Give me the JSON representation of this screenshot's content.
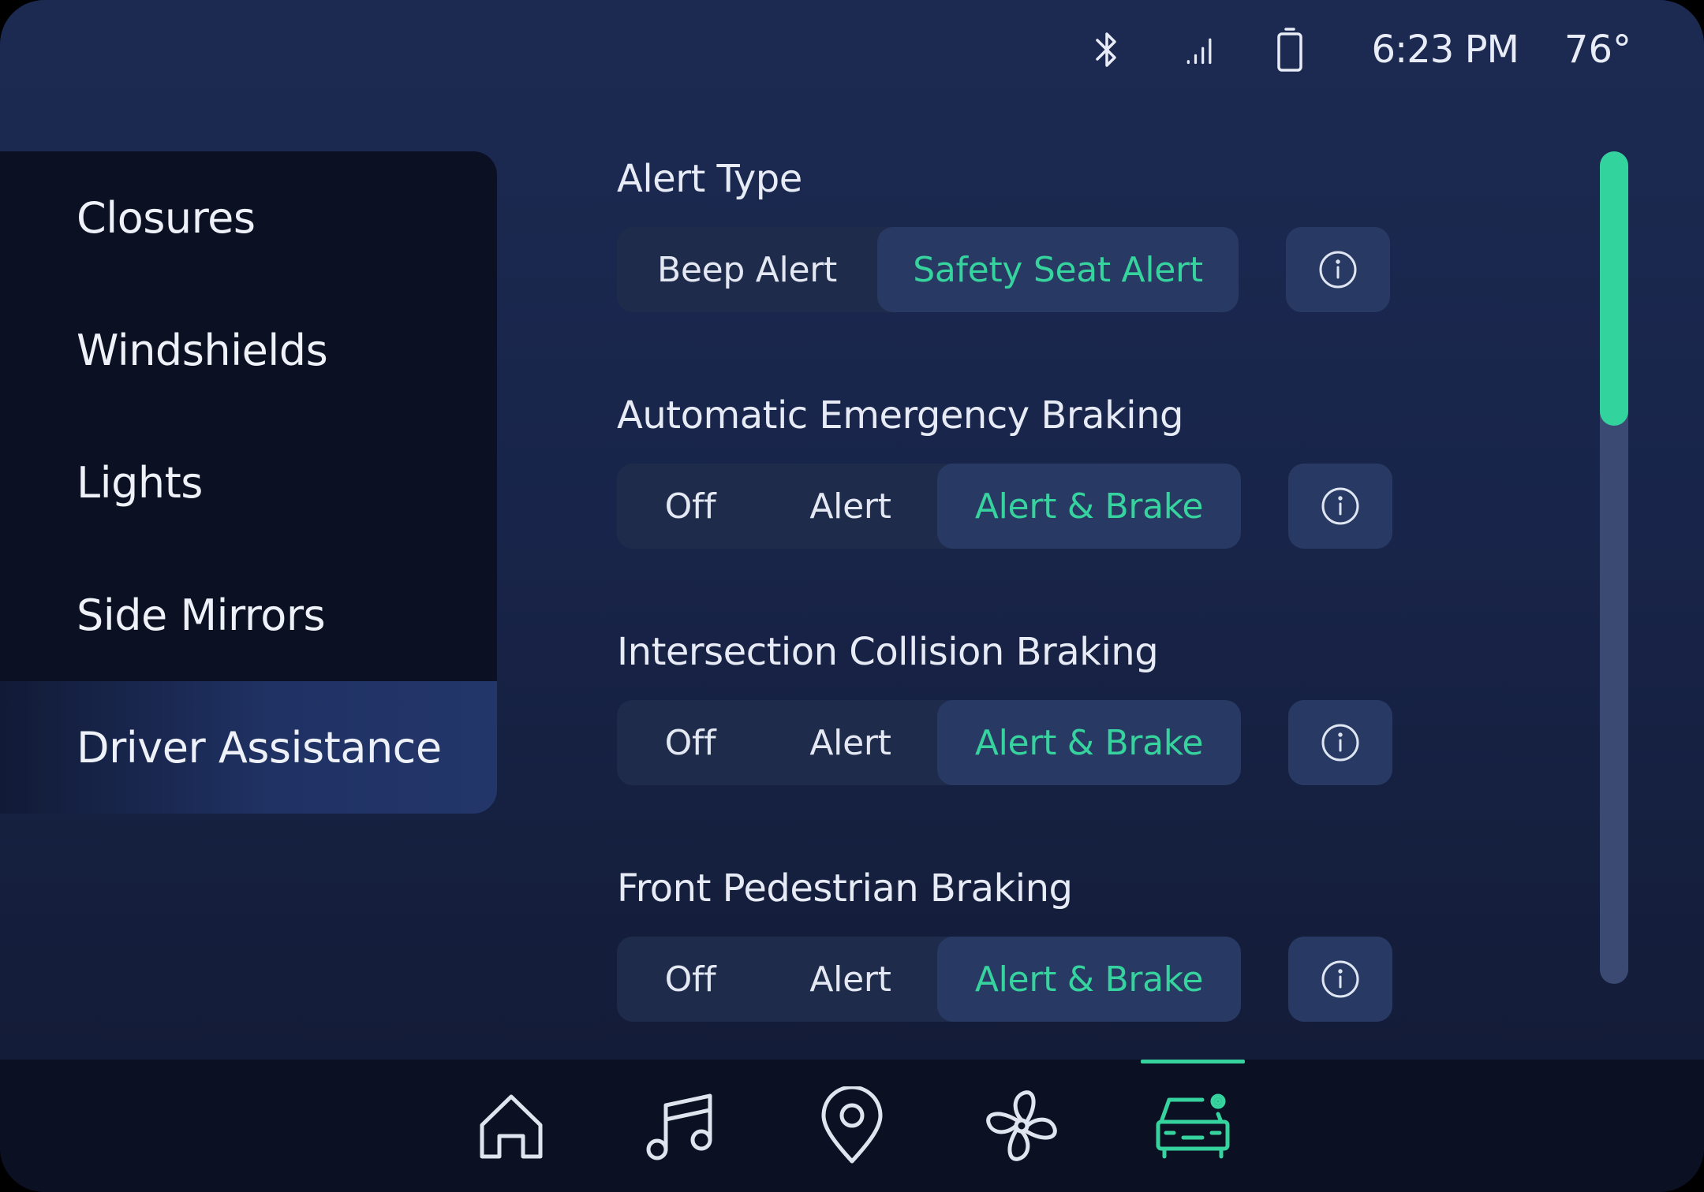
{
  "status_bar": {
    "time": "6:23 PM",
    "temperature": "76°",
    "icons": [
      "bluetooth-icon",
      "signal-icon",
      "battery-icon"
    ]
  },
  "sidebar": {
    "items": [
      {
        "label": "Closures",
        "active": false
      },
      {
        "label": "Windshields",
        "active": false
      },
      {
        "label": "Lights",
        "active": false
      },
      {
        "label": "Side Mirrors",
        "active": false
      },
      {
        "label": "Driver Assistance",
        "active": true
      }
    ]
  },
  "settings": [
    {
      "title": "Alert Type",
      "options": [
        "Beep Alert",
        "Safety Seat Alert"
      ],
      "selected": "Safety Seat Alert"
    },
    {
      "title": "Automatic Emergency Braking",
      "options": [
        "Off",
        "Alert",
        "Alert & Brake"
      ],
      "selected": "Alert & Brake"
    },
    {
      "title": "Intersection Collision Braking",
      "options": [
        "Off",
        "Alert",
        "Alert & Brake"
      ],
      "selected": "Alert & Brake"
    },
    {
      "title": "Front Pedestrian Braking",
      "options": [
        "Off",
        "Alert",
        "Alert & Brake"
      ],
      "selected": "Alert & Brake"
    }
  ],
  "scrollbar": {
    "position_fraction": 0.0,
    "visible_fraction": 0.33
  },
  "bottom_nav": {
    "items": [
      "home-icon",
      "music-icon",
      "location-pin-icon",
      "fan-icon",
      "car-settings-icon"
    ],
    "active": "car-settings-icon"
  },
  "colors": {
    "accent": "#36d39e",
    "background": "#1a2650",
    "sidebar": "#0b1023",
    "control": "#1f2b4b",
    "control_selected": "#283a63"
  }
}
